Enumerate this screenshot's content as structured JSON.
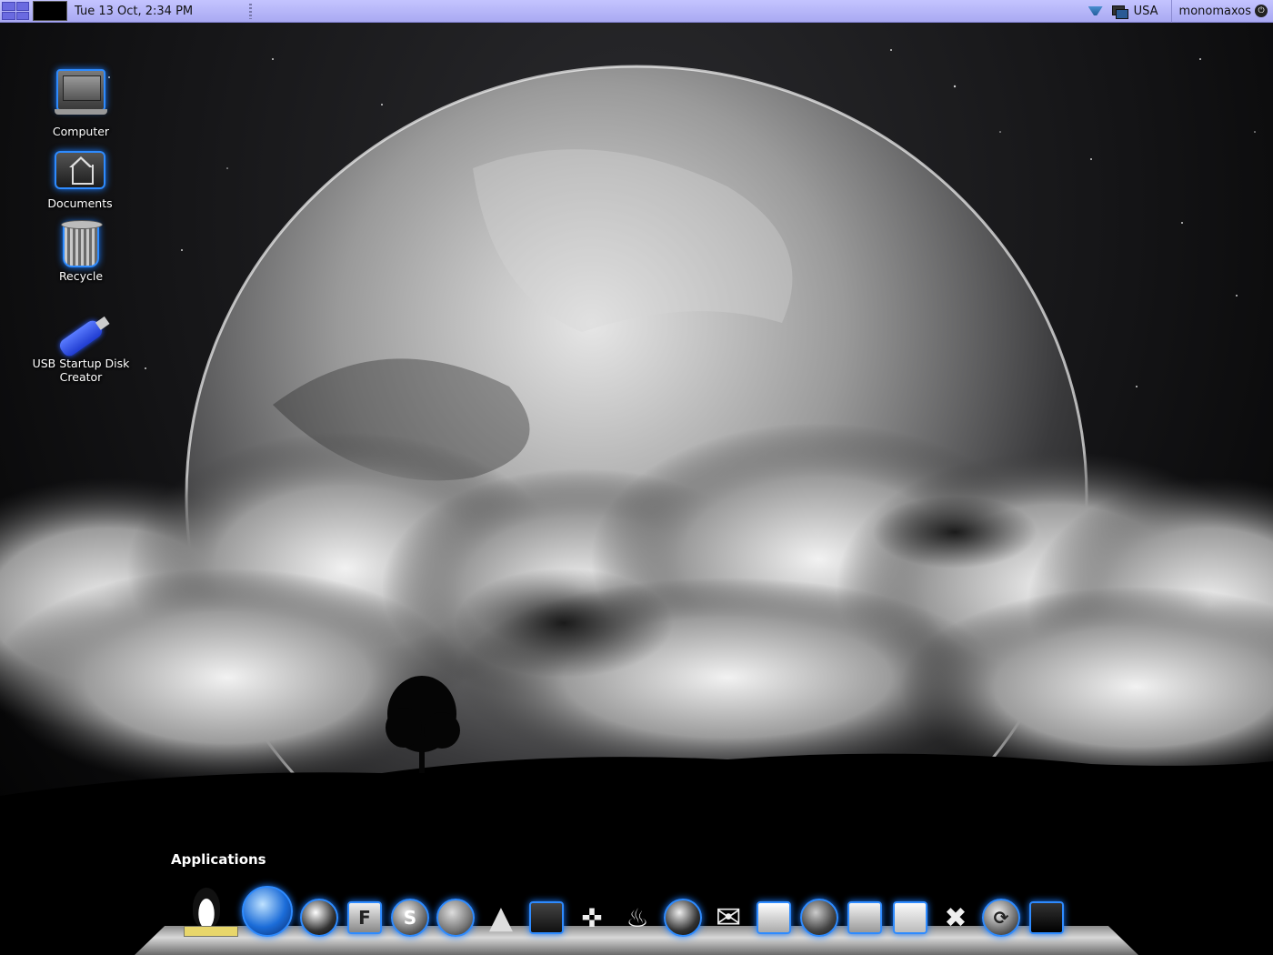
{
  "top_panel": {
    "clock": "Tue 13 Oct,  2:34 PM",
    "keyboard_layout": "USA",
    "username": "monomaxos"
  },
  "desktop": {
    "icons": [
      {
        "label": "Computer",
        "icon": "computer-icon"
      },
      {
        "label": "Documents",
        "icon": "home-folder-icon"
      },
      {
        "label": "Recycle",
        "icon": "trash-icon"
      },
      {
        "label": "USB Startup Disk Creator",
        "icon": "usb-drive-icon"
      }
    ]
  },
  "dock": {
    "title": "Applications",
    "items": [
      {
        "icon": "tux-mascot-icon"
      },
      {
        "icon": "dolphin-file-manager-icon"
      },
      {
        "icon": "google-earth-icon"
      },
      {
        "icon": "text-editor-icon"
      },
      {
        "icon": "skype-icon"
      },
      {
        "icon": "messenger-contacts-icon"
      },
      {
        "icon": "vlc-cone-icon"
      },
      {
        "icon": "system-monitor-icon"
      },
      {
        "icon": "gamepad-icon"
      },
      {
        "icon": "burner-flame-icon"
      },
      {
        "icon": "web-browser-globe-icon"
      },
      {
        "icon": "mail-envelope-icon"
      },
      {
        "icon": "office-suite-icon"
      },
      {
        "icon": "network-sync-icon"
      },
      {
        "icon": "printer-icon"
      },
      {
        "icon": "file-copy-icon"
      },
      {
        "icon": "tools-settings-icon"
      },
      {
        "icon": "update-refresh-icon"
      },
      {
        "icon": "terminal-icon"
      }
    ]
  },
  "colors": {
    "panel_bg": "#b8b8fa",
    "icon_glow": "#2e8bff"
  }
}
